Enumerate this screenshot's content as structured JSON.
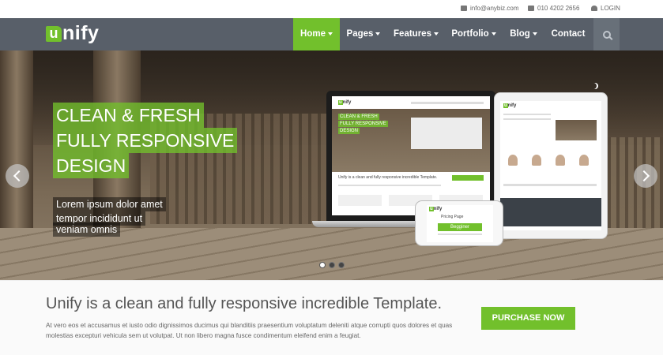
{
  "topbar": {
    "email": "info@anybiz.com",
    "phone": "010 4202 2656",
    "login": "LOGIN",
    "email_icon": "envelope-icon",
    "phone_icon": "phone-icon",
    "login_icon": "user-icon"
  },
  "brand": {
    "logo_first": "u",
    "logo_rest": "nify"
  },
  "nav": {
    "items": [
      {
        "label": "Home",
        "active": true
      },
      {
        "label": "Pages",
        "active": false
      },
      {
        "label": "Features",
        "active": false
      },
      {
        "label": "Portfolio",
        "active": false
      },
      {
        "label": "Blog",
        "active": false
      },
      {
        "label": "Contact",
        "active": false
      }
    ],
    "search_icon": "search-icon"
  },
  "hero": {
    "headline_lines": [
      "CLEAN & FRESH",
      "FULLY RESPONSIVE",
      "DESIGN"
    ],
    "sub_lines": [
      "Lorem ipsum dolor amet",
      "tempor incididunt ut",
      "veniam omnis"
    ],
    "slide_count": 3,
    "active_slide": 1
  },
  "mockup": {
    "laptop_logo": "nify",
    "laptop_headline": [
      "CLEAN & FRESH",
      "FULLY RESPONSIVE",
      "DESIGN"
    ],
    "laptop_tagline": "Unify is a clean and fully responsive incredible Template.",
    "phone_title": "Pricing Page",
    "phone_plan": "Begginer"
  },
  "purchase": {
    "title": "Unify is a clean and fully responsive incredible Template.",
    "text": "At vero eos et accusamus et iusto odio dignissimos ducimus qui blanditiis praesentium voluptatum deleniti atque corrupti quos dolores et quas molestias excepturi vehicula sem ut volutpat. Ut non libero magna fusce condimentum eleifend enim a feugiat.",
    "button": "PURCHASE NOW"
  },
  "colors": {
    "accent": "#72c02c",
    "nav_bg": "#585f69"
  }
}
